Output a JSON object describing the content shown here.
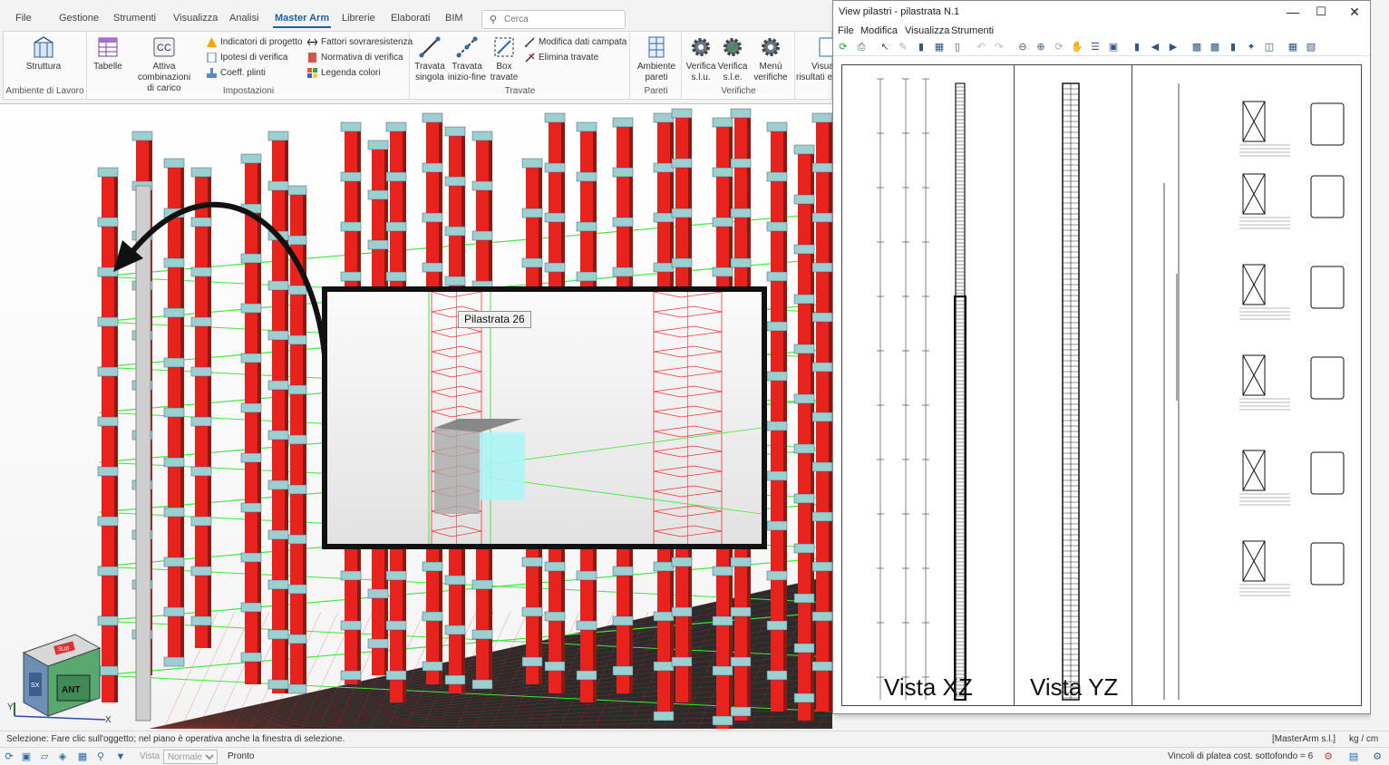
{
  "menu": {
    "items": [
      "File",
      "Gestione",
      "Strumenti",
      "Visualizza",
      "Analisi",
      "Master Arm",
      "Librerie",
      "Elaborati",
      "BIM"
    ],
    "active": "Master Arm",
    "search_placeholder": "Cerca"
  },
  "ribbon": {
    "ambiente": {
      "name": "Ambiente di Lavoro",
      "struttura": "Struttura"
    },
    "impostazioni": {
      "name": "Impostazioni",
      "tabelle": "Tabelle",
      "attiva_line1": "Attiva combinazioni",
      "attiva_line2": "di carico",
      "indicatori": "Indicatori di progetto",
      "ipotesi": "Ipotesi di verifica",
      "coeff": "Coeff. plinti",
      "fattori": "Fattori sovraresistenza",
      "normativa": "Normativa di verifica",
      "legenda": "Legenda colori"
    },
    "travate": {
      "name": "Travate",
      "singola_l1": "Travata",
      "singola_l2": "singola",
      "iniziofine_l1": "Travata",
      "iniziofine_l2": "inizio-fine",
      "box_l1": "Box",
      "box_l2": "travate",
      "modifica": "Modifica dati campata",
      "elimina": "Elimina travate"
    },
    "pareti": {
      "name": "Pareti",
      "ambiente_l1": "Ambiente",
      "ambiente_l2": "pareti"
    },
    "verifiche": {
      "name": "Verifiche",
      "slu_l1": "Verifica",
      "slu_l2": "s.l.u.",
      "sle_l1": "Verifica",
      "sle_l2": "s.l.e.",
      "menu_l1": "Menù",
      "menu_l2": "verifiche"
    },
    "visual": {
      "l1": "Visual",
      "l2": "risultati e"
    }
  },
  "viewport": {
    "tooltip": "Pilastrata 26",
    "cube_front": "ANT",
    "cube_side": "SX",
    "cube_top": "SUP",
    "axis_x": "X",
    "axis_y": "Y",
    "colors": {
      "column": "#e8231d",
      "beam": "#3fe63f",
      "plate": "#2b2b2b"
    }
  },
  "side_window": {
    "title": "View pilastri - pilastrata N.1",
    "menu": [
      "File",
      "Modifica",
      "Visualizza",
      "Strumenti"
    ],
    "label_xz": "Vista XZ",
    "label_yz": "Vista YZ"
  },
  "status": {
    "message": "Selezione: Fare clic sull'oggetto; nel piano è operativa anche la finestra di selezione.",
    "module": "[MasterArm s.l.]",
    "units": "kg / cm"
  },
  "bottombar": {
    "vista_label": "Vista :",
    "vista_value": "Normale",
    "ready": "Pronto",
    "vincoli": "Vincoli di platea cost. sottofondo = 6"
  }
}
